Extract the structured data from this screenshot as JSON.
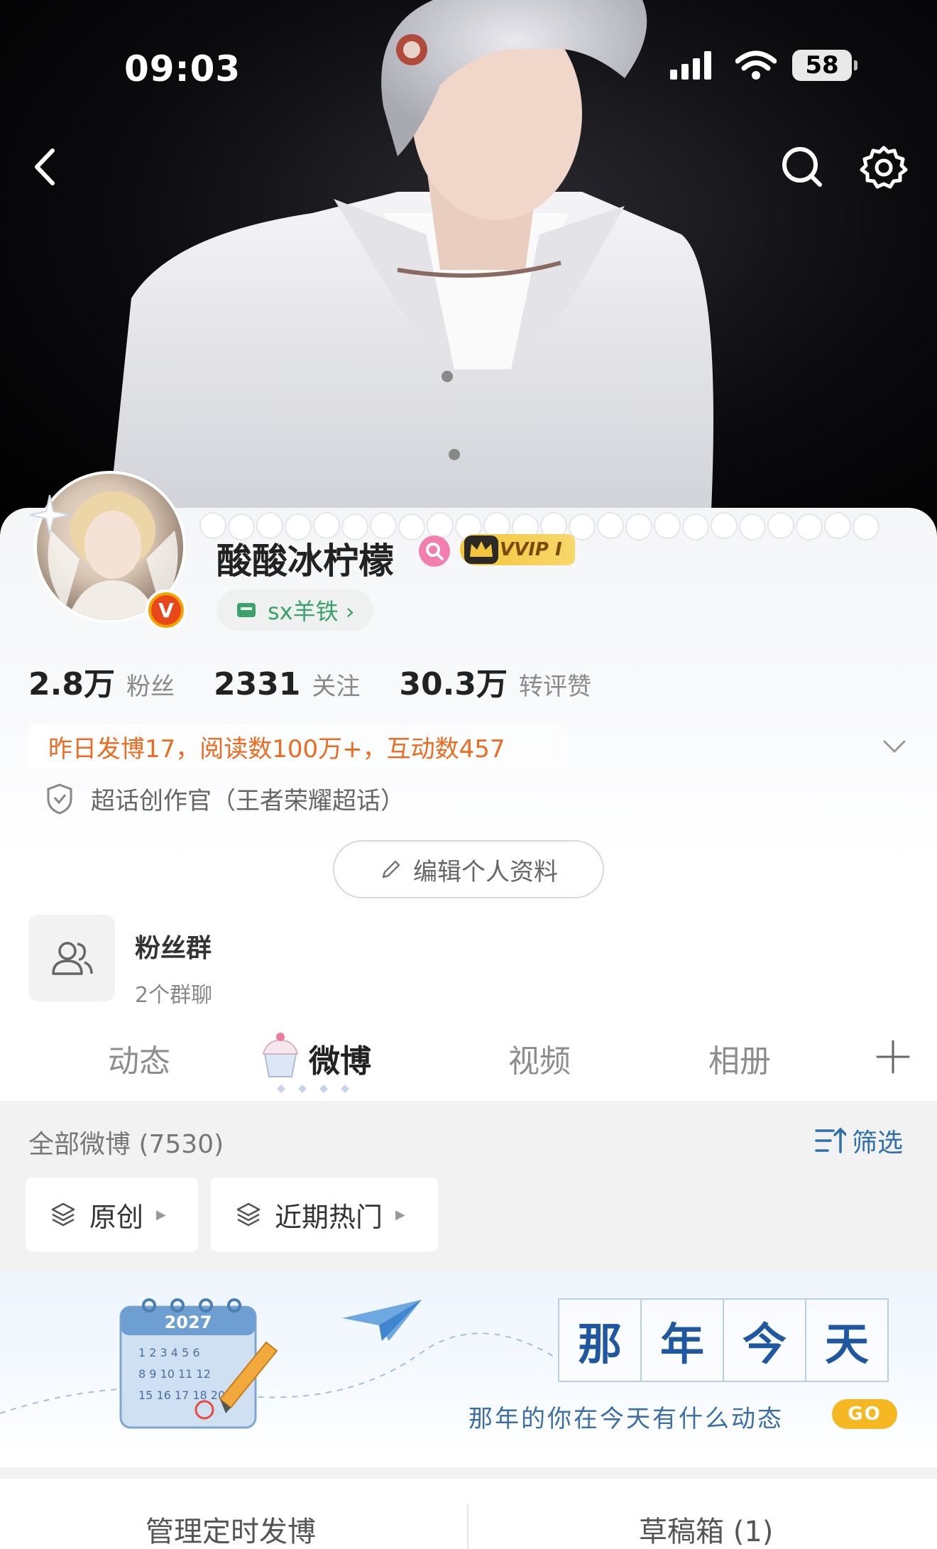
{
  "status_bar": {
    "time": "09:03",
    "battery": "58"
  },
  "profile": {
    "username": "酸酸冰柠檬",
    "vip_label": "VVIP I",
    "group_tag": "sx羊铁 ›",
    "stats": [
      {
        "value": "2.8万",
        "label": "粉丝"
      },
      {
        "value": "2331",
        "label": "关注"
      },
      {
        "value": "30.3万",
        "label": "转评赞"
      }
    ],
    "yesterday_summary": "昨日发博17，阅读数100万+，互动数457",
    "creator_title": "超话创作官（王者荣耀超话）",
    "edit_button": "编辑个人资料"
  },
  "fan_group": {
    "title": "粉丝群",
    "subtitle": "2个群聊"
  },
  "tabs": [
    {
      "label": "动态",
      "active": false
    },
    {
      "label": "微博",
      "active": true
    },
    {
      "label": "视频",
      "active": false
    },
    {
      "label": "相册",
      "active": false
    }
  ],
  "feed": {
    "title": "全部微博 (7530)",
    "filter_label": "筛选",
    "chips": [
      "原创",
      "近期热门"
    ]
  },
  "banner": {
    "title_chars": [
      "那",
      "年",
      "今",
      "天"
    ],
    "subtitle": "那年的你在今天有什么动态",
    "go_label": "GO",
    "calendar_year": "2027"
  },
  "bottom_links": [
    "管理定时发博",
    "草稿箱 (1)"
  ],
  "colors": {
    "accent_orange": "#ef6a1f",
    "link_blue": "#2f6fb0",
    "green_tag": "#3aa26a",
    "vip_gold": "#f3c53c"
  }
}
